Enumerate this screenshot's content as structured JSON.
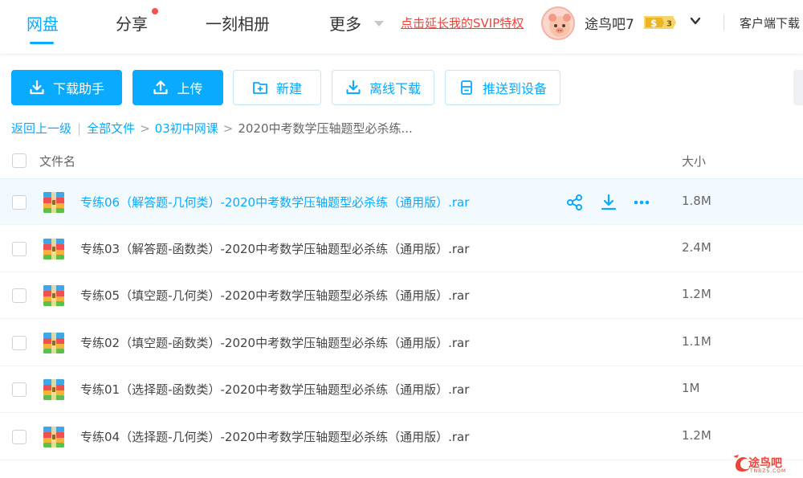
{
  "nav": {
    "tabs": [
      {
        "label": "网盘",
        "active": true
      },
      {
        "label": "分享",
        "active": false
      },
      {
        "label": "一刻相册",
        "active": false
      },
      {
        "label": "更多",
        "active": false
      }
    ],
    "promo": "点击延长我的SVIP特权",
    "username": "途鸟吧7",
    "badge_level": "3",
    "client_download": "客户端下载"
  },
  "toolbar": {
    "download_helper": "下载助手",
    "upload": "上传",
    "new": "新建",
    "offline_download": "离线下载",
    "push_to_device": "推送到设备"
  },
  "breadcrumb": {
    "back": "返回上一级",
    "items": [
      "全部文件",
      "03初中网课"
    ],
    "current": "2020中考数学压轴题型必杀练..."
  },
  "list": {
    "header": {
      "name": "文件名",
      "size": "大小"
    },
    "rows": [
      {
        "name": "专练06（解答题-几何类）-2020中考数学压轴题型必杀练（通用版）.rar",
        "size": "1.8M"
      },
      {
        "name": "专练03（解答题-函数类）-2020中考数学压轴题型必杀练（通用版）.rar",
        "size": "2.4M"
      },
      {
        "name": "专练05（填空题-几何类）-2020中考数学压轴题型必杀练（通用版）.rar",
        "size": "1.2M"
      },
      {
        "name": "专练02（填空题-函数类）-2020中考数学压轴题型必杀练（通用版）.rar",
        "size": "1.1M"
      },
      {
        "name": "专练01（选择题-函数类）-2020中考数学压轴题型必杀练（通用版）.rar",
        "size": "1M"
      },
      {
        "name": "专练04（选择题-几何类）-2020中考数学压轴题型必杀练（通用版）.rar",
        "size": "1.2M"
      }
    ]
  },
  "watermark": {
    "text": "途鸟吧",
    "sub": "TNBZS.COM"
  },
  "colors": {
    "accent": "#09aaff",
    "promo": "#e8453c",
    "hover_row": "#f2faff"
  },
  "icons": [
    "download-icon",
    "upload-icon",
    "new-folder-icon",
    "offline-download-icon",
    "push-device-icon",
    "share-icon",
    "more-icon",
    "rar-archive-icon",
    "chevron-down-icon",
    "svip-badge-icon",
    "avatar-icon"
  ]
}
